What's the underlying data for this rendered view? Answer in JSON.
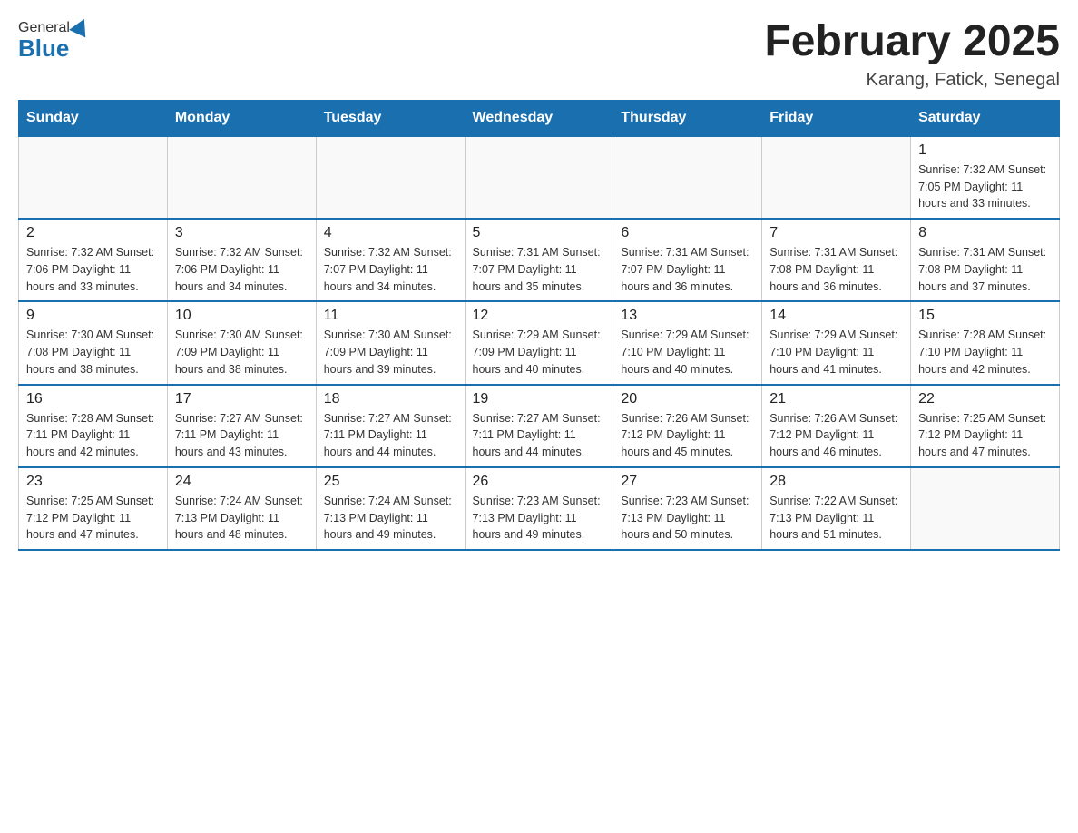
{
  "header": {
    "logo_general": "General",
    "logo_blue": "Blue",
    "month_year": "February 2025",
    "location": "Karang, Fatick, Senegal"
  },
  "days_of_week": [
    "Sunday",
    "Monday",
    "Tuesday",
    "Wednesday",
    "Thursday",
    "Friday",
    "Saturday"
  ],
  "weeks": [
    [
      {
        "day": "",
        "info": ""
      },
      {
        "day": "",
        "info": ""
      },
      {
        "day": "",
        "info": ""
      },
      {
        "day": "",
        "info": ""
      },
      {
        "day": "",
        "info": ""
      },
      {
        "day": "",
        "info": ""
      },
      {
        "day": "1",
        "info": "Sunrise: 7:32 AM\nSunset: 7:05 PM\nDaylight: 11 hours and 33 minutes."
      }
    ],
    [
      {
        "day": "2",
        "info": "Sunrise: 7:32 AM\nSunset: 7:06 PM\nDaylight: 11 hours and 33 minutes."
      },
      {
        "day": "3",
        "info": "Sunrise: 7:32 AM\nSunset: 7:06 PM\nDaylight: 11 hours and 34 minutes."
      },
      {
        "day": "4",
        "info": "Sunrise: 7:32 AM\nSunset: 7:07 PM\nDaylight: 11 hours and 34 minutes."
      },
      {
        "day": "5",
        "info": "Sunrise: 7:31 AM\nSunset: 7:07 PM\nDaylight: 11 hours and 35 minutes."
      },
      {
        "day": "6",
        "info": "Sunrise: 7:31 AM\nSunset: 7:07 PM\nDaylight: 11 hours and 36 minutes."
      },
      {
        "day": "7",
        "info": "Sunrise: 7:31 AM\nSunset: 7:08 PM\nDaylight: 11 hours and 36 minutes."
      },
      {
        "day": "8",
        "info": "Sunrise: 7:31 AM\nSunset: 7:08 PM\nDaylight: 11 hours and 37 minutes."
      }
    ],
    [
      {
        "day": "9",
        "info": "Sunrise: 7:30 AM\nSunset: 7:08 PM\nDaylight: 11 hours and 38 minutes."
      },
      {
        "day": "10",
        "info": "Sunrise: 7:30 AM\nSunset: 7:09 PM\nDaylight: 11 hours and 38 minutes."
      },
      {
        "day": "11",
        "info": "Sunrise: 7:30 AM\nSunset: 7:09 PM\nDaylight: 11 hours and 39 minutes."
      },
      {
        "day": "12",
        "info": "Sunrise: 7:29 AM\nSunset: 7:09 PM\nDaylight: 11 hours and 40 minutes."
      },
      {
        "day": "13",
        "info": "Sunrise: 7:29 AM\nSunset: 7:10 PM\nDaylight: 11 hours and 40 minutes."
      },
      {
        "day": "14",
        "info": "Sunrise: 7:29 AM\nSunset: 7:10 PM\nDaylight: 11 hours and 41 minutes."
      },
      {
        "day": "15",
        "info": "Sunrise: 7:28 AM\nSunset: 7:10 PM\nDaylight: 11 hours and 42 minutes."
      }
    ],
    [
      {
        "day": "16",
        "info": "Sunrise: 7:28 AM\nSunset: 7:11 PM\nDaylight: 11 hours and 42 minutes."
      },
      {
        "day": "17",
        "info": "Sunrise: 7:27 AM\nSunset: 7:11 PM\nDaylight: 11 hours and 43 minutes."
      },
      {
        "day": "18",
        "info": "Sunrise: 7:27 AM\nSunset: 7:11 PM\nDaylight: 11 hours and 44 minutes."
      },
      {
        "day": "19",
        "info": "Sunrise: 7:27 AM\nSunset: 7:11 PM\nDaylight: 11 hours and 44 minutes."
      },
      {
        "day": "20",
        "info": "Sunrise: 7:26 AM\nSunset: 7:12 PM\nDaylight: 11 hours and 45 minutes."
      },
      {
        "day": "21",
        "info": "Sunrise: 7:26 AM\nSunset: 7:12 PM\nDaylight: 11 hours and 46 minutes."
      },
      {
        "day": "22",
        "info": "Sunrise: 7:25 AM\nSunset: 7:12 PM\nDaylight: 11 hours and 47 minutes."
      }
    ],
    [
      {
        "day": "23",
        "info": "Sunrise: 7:25 AM\nSunset: 7:12 PM\nDaylight: 11 hours and 47 minutes."
      },
      {
        "day": "24",
        "info": "Sunrise: 7:24 AM\nSunset: 7:13 PM\nDaylight: 11 hours and 48 minutes."
      },
      {
        "day": "25",
        "info": "Sunrise: 7:24 AM\nSunset: 7:13 PM\nDaylight: 11 hours and 49 minutes."
      },
      {
        "day": "26",
        "info": "Sunrise: 7:23 AM\nSunset: 7:13 PM\nDaylight: 11 hours and 49 minutes."
      },
      {
        "day": "27",
        "info": "Sunrise: 7:23 AM\nSunset: 7:13 PM\nDaylight: 11 hours and 50 minutes."
      },
      {
        "day": "28",
        "info": "Sunrise: 7:22 AM\nSunset: 7:13 PM\nDaylight: 11 hours and 51 minutes."
      },
      {
        "day": "",
        "info": ""
      }
    ]
  ]
}
